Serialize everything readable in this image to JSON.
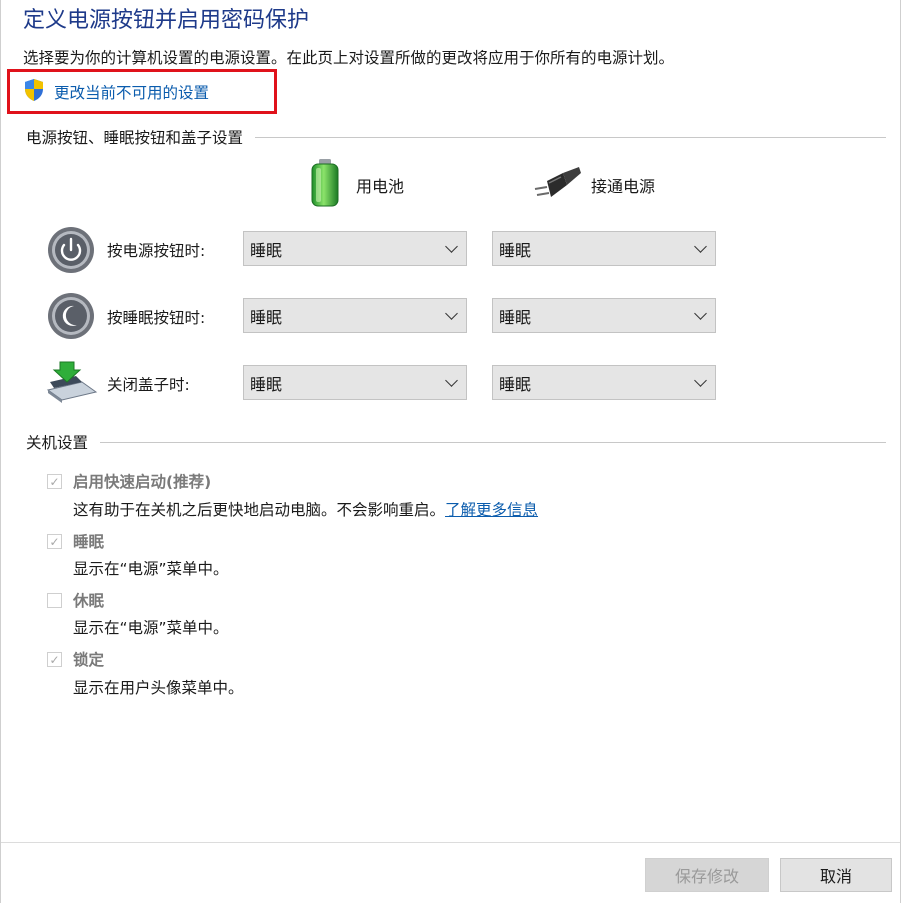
{
  "header": {
    "title": "定义电源按钮并启用密码保护",
    "intro": "选择要为你的计算机设置的电源设置。在此页上对设置所做的更改将应用于你所有的电源计划。",
    "admin_link": "更改当前不可用的设置"
  },
  "buttons_section": {
    "heading": "电源按钮、睡眠按钮和盖子设置",
    "columns": {
      "battery": "用电池",
      "plugged_in": "接通电源"
    },
    "rows": [
      {
        "label": "按电源按钮时:",
        "battery": "睡眠",
        "plugged_in": "睡眠",
        "icon": "power-button-icon"
      },
      {
        "label": "按睡眠按钮时:",
        "battery": "睡眠",
        "plugged_in": "睡眠",
        "icon": "sleep-button-icon"
      },
      {
        "label": "关闭盖子时:",
        "battery": "睡眠",
        "plugged_in": "睡眠",
        "icon": "laptop-lid-icon"
      }
    ]
  },
  "shutdown_section": {
    "heading": "关机设置",
    "items": [
      {
        "label": "启用快速启动(推荐)",
        "desc": "这有助于在关机之后更快地启动电脑。不会影响重启。",
        "link": "了解更多信息",
        "checked": true
      },
      {
        "label": "睡眠",
        "desc": "显示在“电源”菜单中。",
        "checked": true
      },
      {
        "label": "休眠",
        "desc": "显示在“电源”菜单中。",
        "checked": false
      },
      {
        "label": "锁定",
        "desc": "显示在用户头像菜单中。",
        "checked": true
      }
    ]
  },
  "footer": {
    "save": "保存修改",
    "cancel": "取消"
  },
  "colors": {
    "title": "#1e3a8a",
    "link": "#0b5cad",
    "highlight": "#e0121b"
  }
}
